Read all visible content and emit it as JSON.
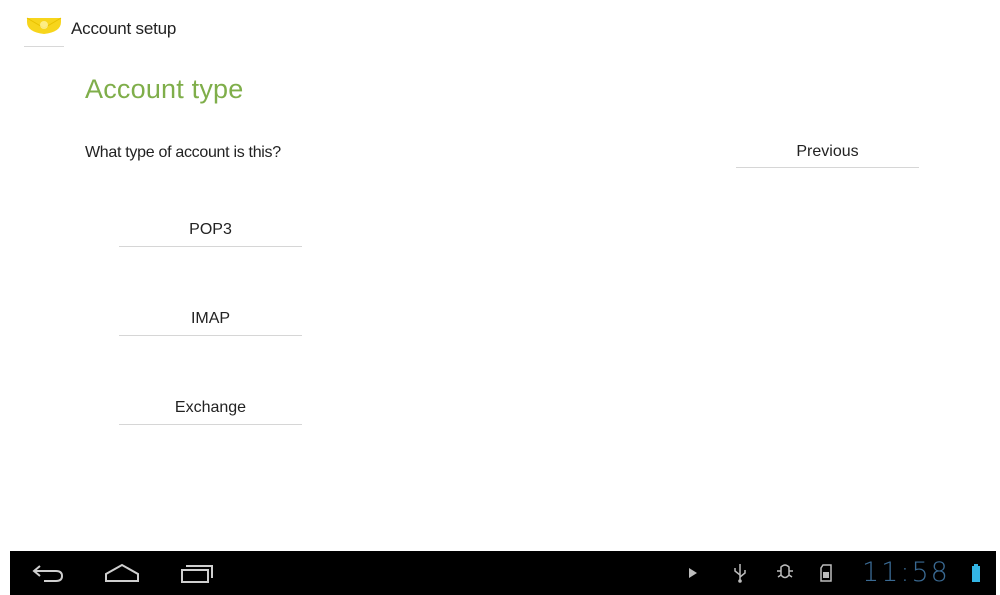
{
  "action_bar": {
    "title": "Account setup",
    "icon": "email-envelope-icon"
  },
  "page": {
    "heading": "Account type",
    "question": "What type of account is this?"
  },
  "buttons": {
    "previous": "Previous",
    "pop3": "POP3",
    "imap": "IMAP",
    "exchange": "Exchange"
  },
  "system_bar": {
    "nav": [
      "back-icon",
      "home-icon",
      "recent-apps-icon"
    ],
    "status_icons": [
      "play-icon",
      "usb-icon",
      "usb-debugging-icon",
      "sd-card-icon",
      "battery-icon"
    ],
    "clock": "11:58"
  },
  "colors": {
    "heading_green": "#7fae4a",
    "clock_blue": "#3a6a93",
    "battery_blue": "#33b5e5",
    "app_icon_yellow": "#f7d51c"
  }
}
